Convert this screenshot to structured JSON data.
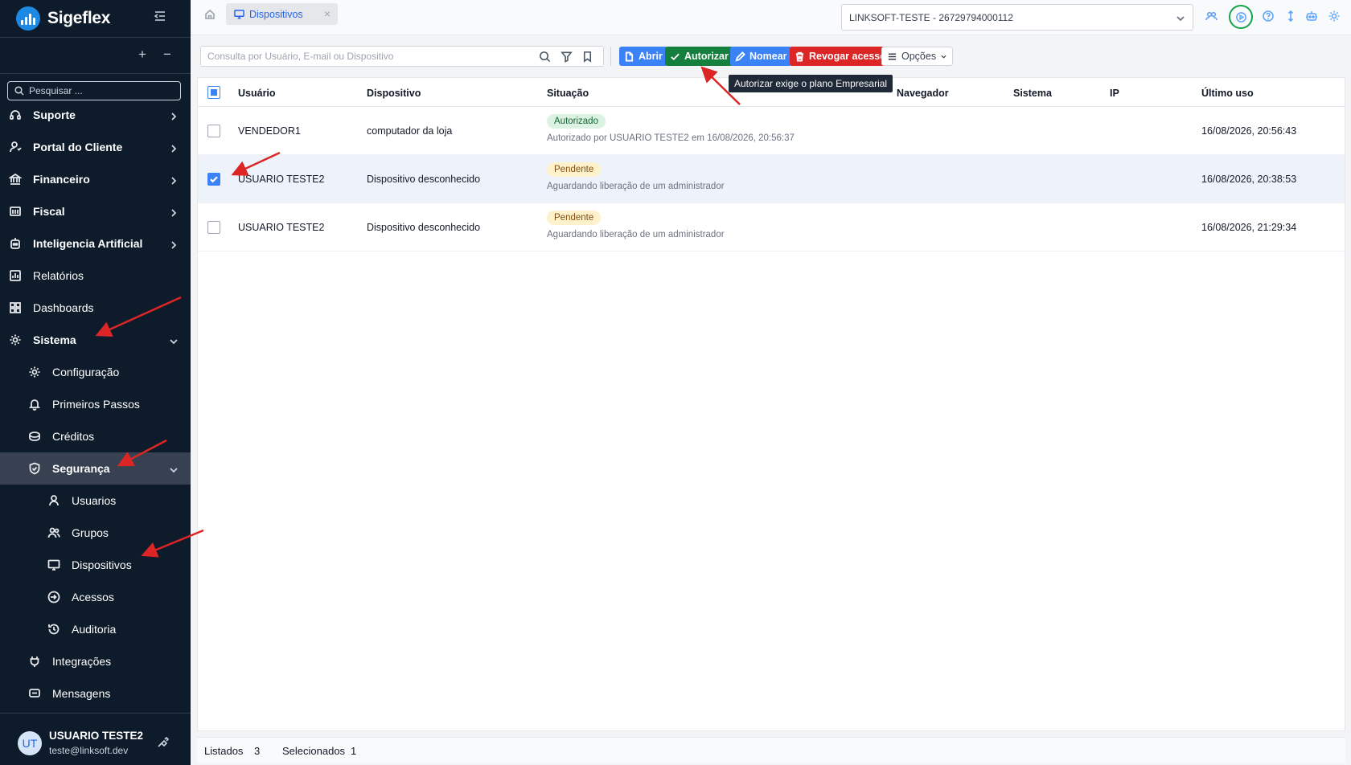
{
  "app": {
    "name": "Sigeflex"
  },
  "sidebar": {
    "search_placeholder": "Pesquisar ...",
    "items": [
      {
        "label": "Suporte",
        "icon": "headset-icon",
        "expanded": false
      },
      {
        "label": "Portal do Cliente",
        "icon": "user-portal-icon",
        "expanded": false
      },
      {
        "label": "Financeiro",
        "icon": "bank-icon",
        "expanded": false
      },
      {
        "label": "Fiscal",
        "icon": "fiscal-icon",
        "expanded": false
      },
      {
        "label": "Inteligencia Artificial",
        "icon": "ai-icon",
        "expanded": false
      },
      {
        "label": "Relatórios",
        "icon": "report-icon"
      },
      {
        "label": "Dashboards",
        "icon": "dashboard-icon"
      },
      {
        "label": "Sistema",
        "icon": "gear-icon",
        "expanded": true
      }
    ],
    "sistema_children": [
      {
        "label": "Configuração",
        "icon": "gear-icon"
      },
      {
        "label": "Primeiros Passos",
        "icon": "bell-icon"
      },
      {
        "label": "Créditos",
        "icon": "coins-icon"
      },
      {
        "label": "Segurança",
        "icon": "shield-icon",
        "expanded": true,
        "active": true
      },
      {
        "label": "Integrações",
        "icon": "plug-icon"
      },
      {
        "label": "Mensagens",
        "icon": "message-icon"
      }
    ],
    "seguranca_children": [
      {
        "label": "Usuarios",
        "icon": "user-icon"
      },
      {
        "label": "Grupos",
        "icon": "users-icon"
      },
      {
        "label": "Dispositivos",
        "icon": "monitor-icon",
        "active": true
      },
      {
        "label": "Acessos",
        "icon": "login-icon"
      },
      {
        "label": "Auditoria",
        "icon": "history-icon"
      }
    ],
    "user": {
      "initials": "UT",
      "name": "USUARIO TESTE2",
      "email": "teste@linksoft.dev"
    }
  },
  "header": {
    "tab_label": "Dispositivos",
    "company": "LINKSOFT-TESTE - 26729794000112"
  },
  "toolbar": {
    "search_placeholder": "Consulta por Usuário, E-mail ou Dispositivo",
    "abrir": "Abrir",
    "autorizar": "Autorizar",
    "nomear": "Nomear",
    "revogar": "Revogar acesso",
    "opcoes": "Opções",
    "tooltip": "Autorizar exige o plano Empresarial"
  },
  "table": {
    "columns": [
      "Usuário",
      "Dispositivo",
      "Situação",
      "Navegador",
      "Sistema",
      "IP",
      "Último uso"
    ],
    "rows": [
      {
        "selected": false,
        "usuario": "VENDEDOR1",
        "dispositivo": "computador da loja",
        "status": "Autorizado",
        "status_type": "ok",
        "detail": "Autorizado por USUARIO TESTE2 em 16/08/2026, 20:56:37",
        "navegador": "",
        "sistema": "",
        "ip": "",
        "ultimo_uso": "16/08/2026, 20:56:43"
      },
      {
        "selected": true,
        "usuario": "USUARIO TESTE2",
        "dispositivo": "Dispositivo desconhecido",
        "status": "Pendente",
        "status_type": "pend",
        "detail": "Aguardando liberação de um administrador",
        "navegador": "",
        "sistema": "",
        "ip": "",
        "ultimo_uso": "16/08/2026, 20:38:53"
      },
      {
        "selected": false,
        "usuario": "USUARIO TESTE2",
        "dispositivo": "Dispositivo desconhecido",
        "status": "Pendente",
        "status_type": "pend",
        "detail": "Aguardando liberação de um administrador",
        "navegador": "",
        "sistema": "",
        "ip": "",
        "ultimo_uso": "16/08/2026, 21:29:34"
      }
    ]
  },
  "footer": {
    "listados_label": "Listados",
    "listados_count": "3",
    "selecionados_label": "Selecionados",
    "selecionados_count": "1"
  },
  "colors": {
    "sidebar_bg": "#0d1b2a",
    "primary": "#3b82f6",
    "success": "#15803d",
    "danger": "#dc2626",
    "annotation_arrow": "#dc2626",
    "annotation_circle": "#16a34a"
  }
}
